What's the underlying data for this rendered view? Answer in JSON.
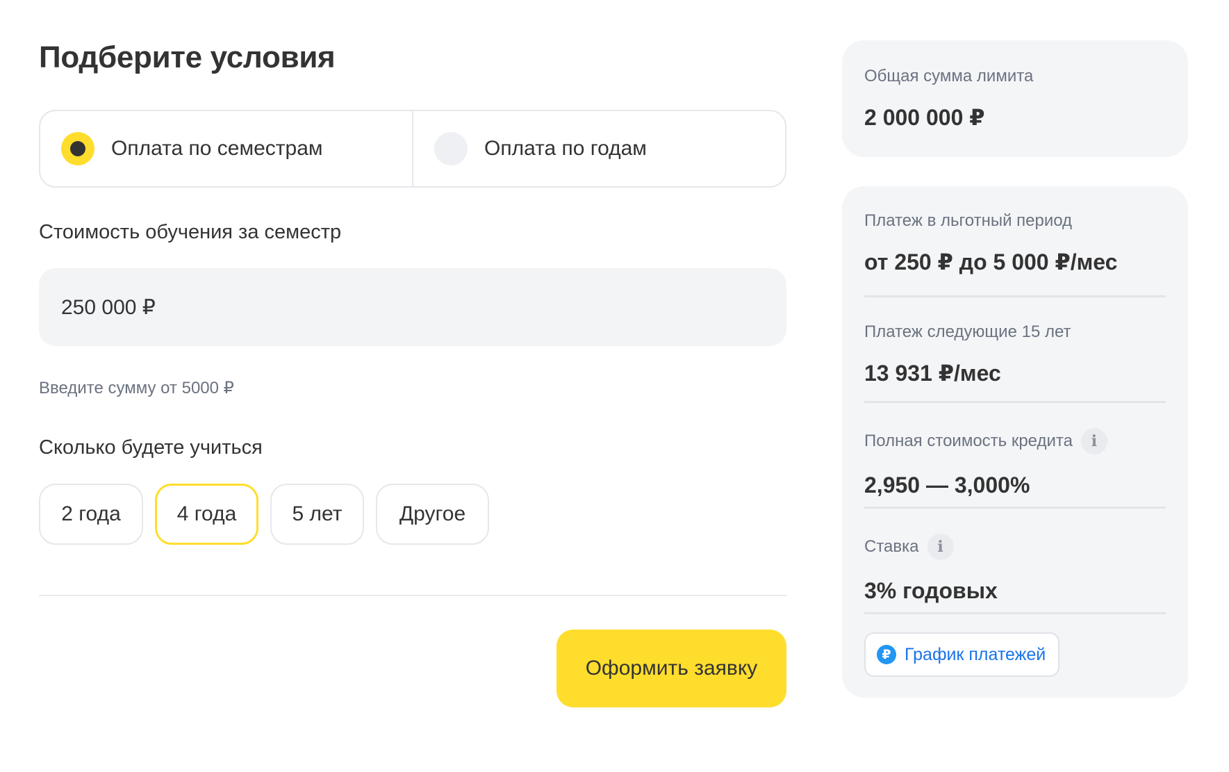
{
  "title": "Подберите условия",
  "payment_mode": {
    "options": [
      {
        "label": "Оплата по семестрам",
        "selected": true
      },
      {
        "label": "Оплата по годам",
        "selected": false
      }
    ]
  },
  "tuition": {
    "label": "Стоимость обучения за семестр",
    "value": "250 000 ₽",
    "hint": "Введите сумму от 5000 ₽"
  },
  "duration": {
    "label": "Сколько будете учиться",
    "options": [
      "2 года",
      "4 года",
      "5 лет",
      "Другое"
    ],
    "selected": "4 года"
  },
  "submit_label": "Оформить заявку",
  "summary": {
    "limit": {
      "label": "Общая сумма лимита",
      "value": "2 000 000 ₽"
    },
    "grace": {
      "label": "Платеж в льготный период",
      "value": "от 250 ₽ до 5 000 ₽/мес"
    },
    "next": {
      "label": "Платеж следующие 15 лет",
      "value": "13 931 ₽/мес"
    },
    "psk": {
      "label": "Полная стоимость кредита",
      "value": "2,950 — 3,000%"
    },
    "rate": {
      "label": "Ставка",
      "value": "3% годовых"
    },
    "schedule_label": "График платежей"
  },
  "colors": {
    "accent": "#ffdd2d",
    "link": "#1a73e8",
    "panel": "#f4f5f7"
  },
  "icons": {
    "info": "info-icon",
    "ruble": "ruble-icon"
  }
}
